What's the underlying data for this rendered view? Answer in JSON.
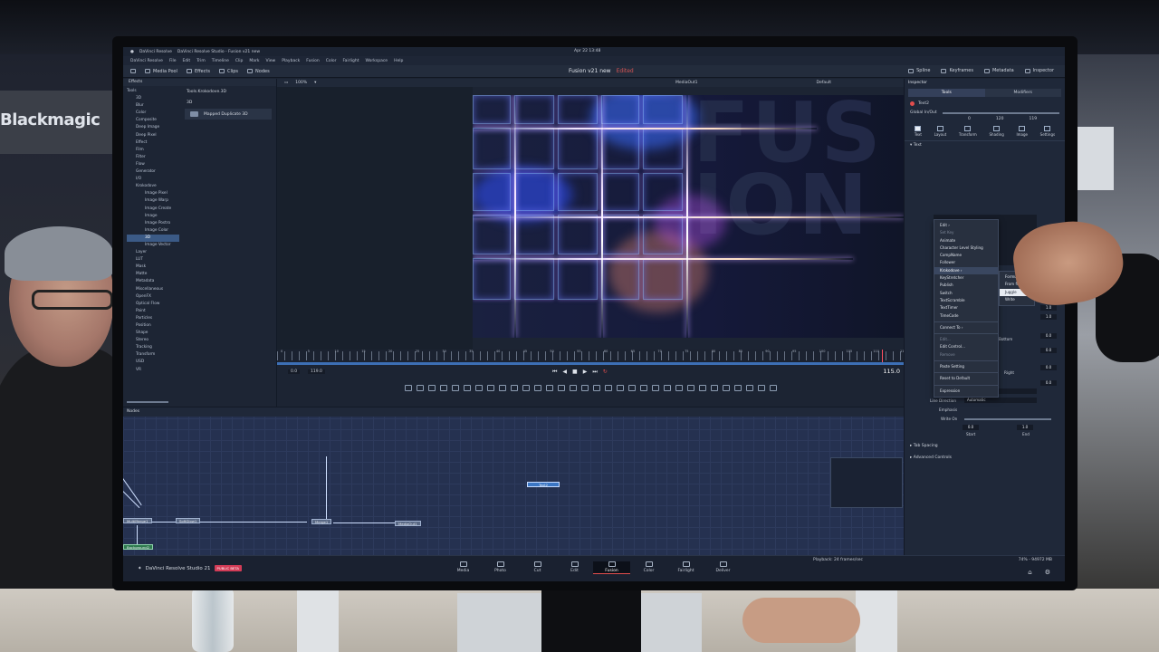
{
  "macos_bar": {
    "app": "DaVinci Resolve",
    "window_title": "DaVinci Resolve Studio - Fusion v21 new",
    "clock": "Apr 22 13:48"
  },
  "app_menu": [
    "DaVinci Resolve",
    "File",
    "Edit",
    "Trim",
    "Timeline",
    "Clip",
    "Mark",
    "View",
    "Playback",
    "Fusion",
    "Color",
    "Fairlight",
    "Workspace",
    "Help"
  ],
  "toolbar": {
    "media_pool": "Media Pool",
    "effects": "Effects",
    "clips": "Clips",
    "nodes": "Nodes",
    "project_title": "Fusion v21 new",
    "edited": "Edited",
    "spline": "Spline",
    "keyframes": "Keyframes",
    "metadata": "Metadata",
    "inspector": "Inspector"
  },
  "effects_panel": {
    "header": "Effects",
    "tree": [
      {
        "label": "Tools",
        "level": 0
      },
      {
        "label": "3D",
        "level": 1
      },
      {
        "label": "Blur",
        "level": 1
      },
      {
        "label": "Color",
        "level": 1
      },
      {
        "label": "Composite",
        "level": 1
      },
      {
        "label": "Deep Image",
        "level": 1
      },
      {
        "label": "Deep Pixel",
        "level": 1
      },
      {
        "label": "Effect",
        "level": 1
      },
      {
        "label": "Film",
        "level": 1
      },
      {
        "label": "Filter",
        "level": 1
      },
      {
        "label": "Flow",
        "level": 1
      },
      {
        "label": "Generator",
        "level": 1
      },
      {
        "label": "I/O",
        "level": 1
      },
      {
        "label": "Krokodove",
        "level": 1
      },
      {
        "label": "Image Pixel",
        "level": 2
      },
      {
        "label": "Image Warp",
        "level": 2
      },
      {
        "label": "Image Create",
        "level": 2
      },
      {
        "label": "Image",
        "level": 2
      },
      {
        "label": "Image Postro",
        "level": 2
      },
      {
        "label": "Image Color",
        "level": 2
      },
      {
        "label": "3D",
        "level": 2,
        "selected": true
      },
      {
        "label": "Image Vector",
        "level": 2
      },
      {
        "label": "Layer",
        "level": 1
      },
      {
        "label": "LUT",
        "level": 1
      },
      {
        "label": "Mask",
        "level": 1
      },
      {
        "label": "Matte",
        "level": 1
      },
      {
        "label": "Metadata",
        "level": 1
      },
      {
        "label": "Miscellaneous",
        "level": 1
      },
      {
        "label": "OpenFX",
        "level": 1
      },
      {
        "label": "Optical Flow",
        "level": 1
      },
      {
        "label": "Paint",
        "level": 1
      },
      {
        "label": "Particles",
        "level": 1
      },
      {
        "label": "Position",
        "level": 1
      },
      {
        "label": "Shape",
        "level": 1
      },
      {
        "label": "Stereo",
        "level": 1
      },
      {
        "label": "Tracking",
        "level": 1
      },
      {
        "label": "Transform",
        "level": 1
      },
      {
        "label": "USD",
        "level": 1
      },
      {
        "label": "VR",
        "level": 1
      }
    ],
    "path": "Tools.Krokodove.3D",
    "group": "3D",
    "items": [
      "Mapped Duplicate 3D"
    ]
  },
  "viewer": {
    "zoom": "100%",
    "name": "MediaOut1",
    "view_mode": "Default",
    "background_text": "FUS ION",
    "in_point": "0.0",
    "out_point": "119.0",
    "current_frame": "115.0",
    "ruler": [
      "0",
      "5",
      "10",
      "15",
      "20",
      "25",
      "30",
      "35",
      "40",
      "45",
      "50",
      "55",
      "60",
      "65",
      "70",
      "75",
      "80",
      "85",
      "90",
      "95",
      "100",
      "105",
      "110",
      "115"
    ],
    "playhead_fraction": 0.966
  },
  "nodes_panel": {
    "header": "Nodes",
    "nodes": [
      "MultiMerge1",
      "SoftGlow1",
      "Merge1",
      "MediaOut1",
      "Text2",
      "Background2"
    ]
  },
  "inspector": {
    "header": "Inspector",
    "tabs": [
      "Tools",
      "Modifiers"
    ],
    "node_name": "Text2",
    "global_label": "Global In/Out",
    "global_in": "0",
    "global_mid": "120",
    "global_out": "119",
    "categories": [
      "Text",
      "Layout",
      "Transform",
      "Shading",
      "Image",
      "Settings"
    ],
    "section_text": "Text",
    "context_menu": [
      {
        "label": "Edit",
        "arrow": true
      },
      {
        "label": "Set Key",
        "dim": true
      },
      {
        "label": "Animate"
      },
      {
        "label": "Character Level Styling"
      },
      {
        "label": "CompName"
      },
      {
        "label": "Follower"
      },
      {
        "label": "Krokodove",
        "arrow": true,
        "highlight": true
      },
      {
        "label": "KeyStretcher"
      },
      {
        "label": "Publish"
      },
      {
        "label": "Switch"
      },
      {
        "label": "TextScramble"
      },
      {
        "label": "TextTimer"
      },
      {
        "label": "TimeCode"
      },
      {
        "sep": true
      },
      {
        "label": "Connect To",
        "arrow": true
      },
      {
        "sep": true
      },
      {
        "label": "Edit...",
        "dim": true
      },
      {
        "label": "Edit Control..."
      },
      {
        "label": "Remove",
        "dim": true
      },
      {
        "sep": true
      },
      {
        "label": "Paste Setting"
      },
      {
        "sep": true
      },
      {
        "label": "Reset to Default"
      },
      {
        "sep": true
      },
      {
        "label": "Expression"
      }
    ],
    "submenu": [
      {
        "label": "Formula"
      },
      {
        "label": "From file"
      },
      {
        "label": "Juggle",
        "highlight": true
      },
      {
        "label": "Write"
      }
    ],
    "values": {
      "v1": "1.0",
      "v2": "1.0",
      "v3": "0.0",
      "v4": "0.0",
      "v5": "0.0",
      "v6": "0.0"
    },
    "side_labels": {
      "bottom": "Bottom",
      "right": "Right"
    },
    "direction_label": "Direction",
    "direction_value": "Automatic",
    "line_direction_label": "Line Direction",
    "line_direction_value": "Automatic",
    "emphasis_label": "Emphasis",
    "write_on_label": "Write On",
    "write_start": "0.0",
    "write_end": "1.0",
    "start_label": "Start",
    "end_label": "End",
    "tab_spacing": "Tab Spacing",
    "advanced_controls": "Advanced Controls"
  },
  "pagebar": {
    "brand": "DaVinci Resolve Studio 21",
    "beta": "PUBLIC BETA",
    "playback": "Playback: 24 frames/sec",
    "memory": "74% - 94972 MB",
    "pages": [
      "Media",
      "Photo",
      "Cut",
      "Edit",
      "Fusion",
      "Color",
      "Fairlight",
      "Deliver"
    ],
    "active_page": "Fusion"
  },
  "environment": {
    "booth_sign": "Blackmagic"
  }
}
